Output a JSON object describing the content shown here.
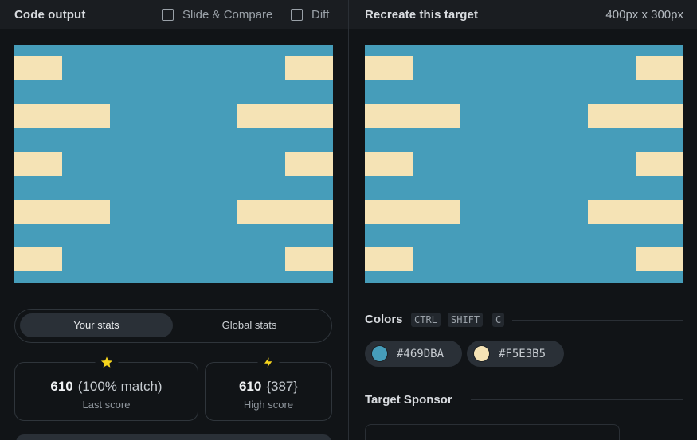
{
  "left": {
    "title": "Code output",
    "checkboxes": {
      "slide_compare": "Slide & Compare",
      "diff": "Diff"
    }
  },
  "right": {
    "title": "Recreate this target",
    "dimensions": "400px x 300px"
  },
  "canvas": {
    "background": "#469DBA",
    "bar_color": "#F5E3B5"
  },
  "stats": {
    "tabs": {
      "your": "Your stats",
      "global": "Global stats"
    },
    "last": {
      "icon": "star-icon",
      "score": "610",
      "detail": "(100% match)",
      "label": "Last score"
    },
    "high": {
      "icon": "lightning-icon",
      "score": "610",
      "detail": "{387}",
      "label": "High score"
    }
  },
  "colors": {
    "title": "Colors",
    "shortcut": [
      "CTRL",
      "SHIFT",
      "C"
    ],
    "items": [
      {
        "hex": "#469DBA",
        "label": "#469DBA"
      },
      {
        "hex": "#F5E3B5",
        "label": "#F5E3B5"
      }
    ]
  },
  "sponsor": {
    "title": "Target Sponsor"
  }
}
